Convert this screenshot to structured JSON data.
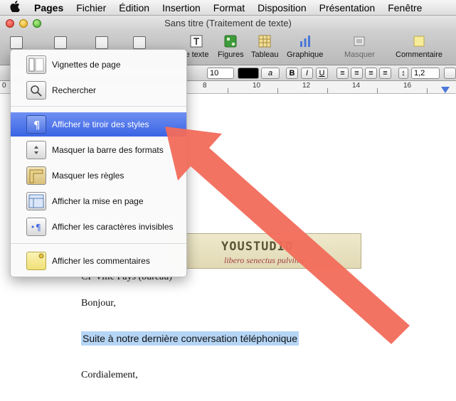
{
  "menubar": {
    "apple_symbol": "",
    "items": [
      "Pages",
      "Fichier",
      "Édition",
      "Insertion",
      "Format",
      "Disposition",
      "Présentation",
      "Fenêtre"
    ]
  },
  "window": {
    "title": "Sans titre (Traitement de texte)"
  },
  "toolbar": {
    "items": [
      {
        "label": "le texte",
        "icon": "text-box-icon"
      },
      {
        "label": "Figures",
        "icon": "shapes-icon"
      },
      {
        "label": "Tableau",
        "icon": "table-icon"
      },
      {
        "label": "Graphique",
        "icon": "chart-icon"
      },
      {
        "label": "Masquer",
        "icon": "mask-icon"
      },
      {
        "label": "Commentaire",
        "icon": "comment-icon"
      }
    ]
  },
  "formatbar": {
    "font_size": "10",
    "text_color_sample": "a",
    "line_spacing": "1,2"
  },
  "ruler": {
    "numbers": [
      "0",
      "8",
      "10",
      "12",
      "14",
      "16"
    ]
  },
  "menu": {
    "items": [
      {
        "label": "Vignettes de page",
        "icon": "page-thumbnails-icon"
      },
      {
        "label": "Rechercher",
        "icon": "search-icon"
      },
      {
        "label": "Afficher le tiroir des styles",
        "icon": "pilcrow-icon",
        "highlighted": true
      },
      {
        "label": "Masquer la barre des formats",
        "icon": "format-bar-icon"
      },
      {
        "label": "Masquer les règles",
        "icon": "ruler-icon"
      },
      {
        "label": "Afficher la mise en page",
        "icon": "layout-icon"
      },
      {
        "label": "Afficher les caractères invisibles",
        "icon": "invisibles-icon"
      },
      {
        "label": "Afficher les commentaires",
        "icon": "comment-icon"
      }
    ]
  },
  "document": {
    "logo_title": "YOUSTUDIO",
    "logo_subtitle": "libero senectus pulvinar",
    "address_line": "CP Ville Pays (bureau)",
    "greeting": "Bonjour,",
    "selected_sentence": "Suite à notre dernière conversation téléphonique",
    "closing": "Cordialement,"
  },
  "colors": {
    "menu_highlight": "#3a64e3",
    "selection": "#b5d5f5",
    "arrow": "#f26b5b"
  }
}
